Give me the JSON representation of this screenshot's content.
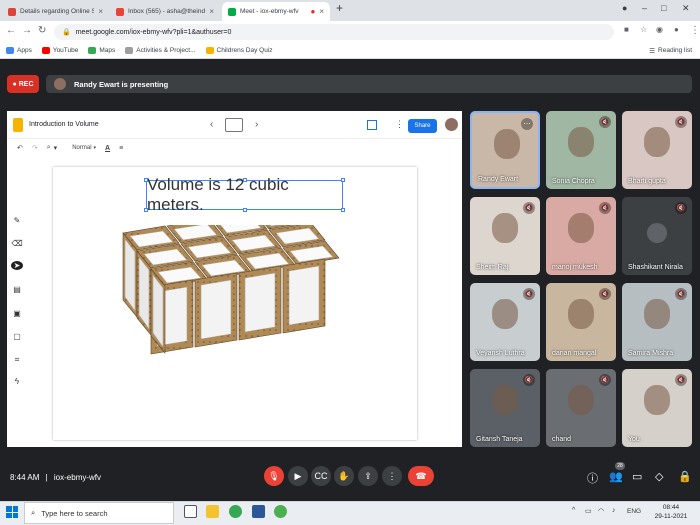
{
  "browser": {
    "tabs": [
      {
        "title": "Details regarding Online Session",
        "color": "#db4437"
      },
      {
        "title": "Inbox (565) - asha@theindiansch",
        "color": "#ea4335"
      },
      {
        "title": "Meet - iox-ebmy-wfv",
        "color": "#00ac47"
      }
    ],
    "url": "meet.google.com/iox-ebmy-wfv?pli=1&authuser=0",
    "bookmarks": [
      {
        "label": "Apps",
        "color": "#4285f4"
      },
      {
        "label": "YouTube",
        "color": "#ff0000"
      },
      {
        "label": "Maps",
        "color": "#34a853"
      },
      {
        "label": "Activities & Project...",
        "color": "#9e9e9e"
      },
      {
        "label": "Childrens Day Quiz",
        "color": "#f4b400"
      }
    ],
    "reading_list": "Reading list"
  },
  "meet": {
    "rec": "REC",
    "presenting": "Randy Ewart is presenting",
    "meeting_code": "iox-ebmy-wfv",
    "time": "8:44 AM",
    "participant_count": "28",
    "participants": [
      {
        "name": "Randy Ewart",
        "color": "#c9b7a7",
        "active": true
      },
      {
        "name": "Sonia Chopra",
        "color": "#9fb7a3"
      },
      {
        "name": "Bharti gupta",
        "color": "#d8c7c2"
      },
      {
        "name": "Sheim Raj",
        "color": "#ddd6cf"
      },
      {
        "name": "manoj mukesh",
        "color": "#d9a9a3"
      },
      {
        "name": "Shashikant Nirala",
        "color": "#3c4043",
        "icon": true
      },
      {
        "name": "Veyansh Luthra",
        "color": "#c8cdd0"
      },
      {
        "name": "darian mangal",
        "color": "#c8b79e"
      },
      {
        "name": "Samira Mishra",
        "color": "#b7bec2"
      },
      {
        "name": "Gitansh Taneja",
        "color": "#5b6066"
      },
      {
        "name": "chand",
        "color": "#6a6e73"
      },
      {
        "name": "You",
        "color": "#d6d0cb"
      }
    ]
  },
  "slides": {
    "doc_title": "Introduction to Volume",
    "share": "Share",
    "font": "Normal",
    "slide_text": "Volume is 12 cubic meters."
  },
  "taskbar": {
    "search_placeholder": "Type here to search",
    "lang": "ENG",
    "clock_time": "08:44",
    "clock_date": "29-11-2021"
  }
}
